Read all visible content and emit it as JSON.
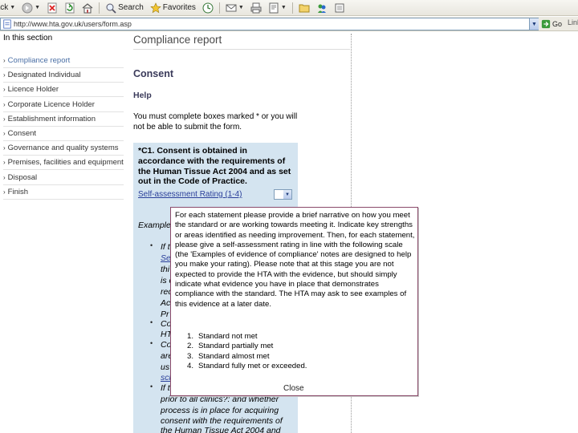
{
  "browser": {
    "toolbar": {
      "back_label": "Back",
      "search_label": "Search",
      "favorites_label": "Favorites"
    },
    "address": {
      "url": "http://www.hta.gov.uk/users/form.asp",
      "go_label": "Go",
      "links_label": "Links"
    }
  },
  "left_nav": {
    "title": "In this section",
    "items": [
      {
        "label": "Compliance report",
        "active": true
      },
      {
        "label": "Designated Individual",
        "active": false
      },
      {
        "label": "Licence Holder",
        "active": false
      },
      {
        "label": "Corporate Licence Holder",
        "active": false
      },
      {
        "label": "Establishment information",
        "active": false
      },
      {
        "label": "Consent",
        "active": false
      },
      {
        "label": "Governance and quality systems",
        "active": false
      },
      {
        "label": "Premises, facilities and equipment",
        "active": false
      },
      {
        "label": "Disposal",
        "active": false
      },
      {
        "label": "Finish",
        "active": false
      }
    ]
  },
  "main": {
    "title": "Compliance report",
    "section": "Consent",
    "help_title": "Help",
    "help_text": "You must complete boxes marked * or you will not be able to submit the form.",
    "question": {
      "text": "*C1. Consent is obtained in accordance with the requirements of the Human Tissue Act 2004 and as set out in the Code of Practice.",
      "rating_link": "Self-assessment Rating (1-4)"
    },
    "examples": {
      "title": "Examples",
      "fragments": [
        "If t",
        "Se",
        "thi",
        "is c",
        "req",
        "Ac",
        "Pr",
        "Co",
        "HT",
        "Co",
        "are",
        "us",
        "sch",
        "If t",
        "prior to all clinics?: and whether",
        "process is in place for acquiring",
        "consent with the requirements of",
        "the Human Tissue Act 2004 and"
      ]
    }
  },
  "popup": {
    "body": "For each statement please provide a brief narrative on how you meet the standard or are working towards meeting it. Indicate key strengths or areas identified as needing improvement. Then, for each statement, please give a self-assessment rating in line with the following scale (the 'Examples of evidence of compliance' notes are designed to help you make your rating). Please note that at this stage you are not expected to provide the HTA with the evidence, but should simply indicate what evidence you have in place that demonstrates compliance with the standard. The HTA may ask to see examples of this evidence at a later date.",
    "scale": [
      {
        "num": "1.",
        "label": "Standard not met"
      },
      {
        "num": "2.",
        "label": "Standard partially met"
      },
      {
        "num": "3.",
        "label": "Standard almost met"
      },
      {
        "num": "4.",
        "label": "Standard fully met or exceeded."
      }
    ],
    "close_label": "Close"
  }
}
